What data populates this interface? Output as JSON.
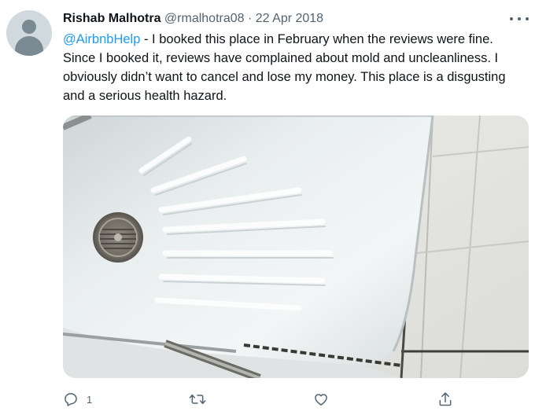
{
  "tweet": {
    "author_name": "Rishab Malhotra",
    "handle": "@rmalhotra08",
    "separator": "·",
    "date": "22 Apr 2018",
    "mention": "@AirbnbHelp",
    "body": " - I booked this place in February when the reviews were fine. Since I booked it, reviews have complained about mold and uncleanliness. I obviously didn’t want to cancel and lose my money. This place is a disgusting and a serious health hazard.",
    "reply_count": "1"
  },
  "icons": {
    "avatar": "default-avatar-icon",
    "more": "more-options-icon",
    "reply": "reply-icon",
    "retweet": "retweet-icon",
    "like": "heart-icon",
    "share": "share-icon"
  },
  "colors": {
    "link": "#1d9bf0",
    "secondary_text": "#536471",
    "primary_text": "#0f1419"
  }
}
